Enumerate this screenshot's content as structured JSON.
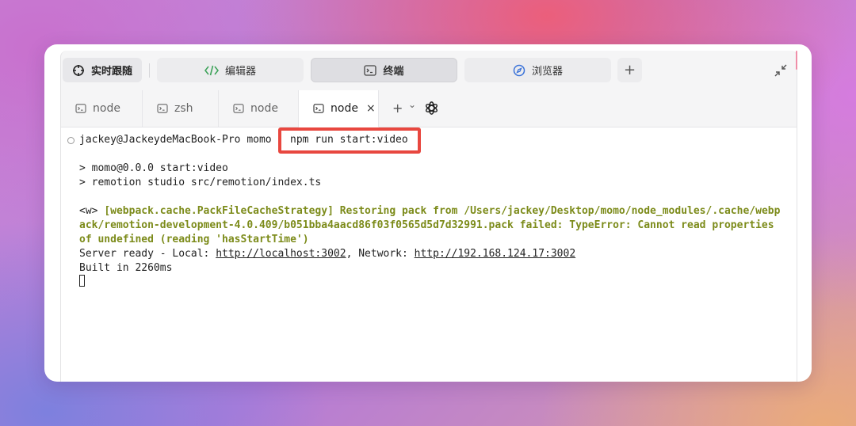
{
  "topbar": {
    "follow_label": "实时跟随",
    "editor_label": "编辑器",
    "terminal_label": "终端",
    "browser_label": "浏览器",
    "add_label": "+"
  },
  "tabs": [
    {
      "label": "node",
      "active": false
    },
    {
      "label": "zsh",
      "active": false
    },
    {
      "label": "node",
      "active": false
    },
    {
      "label": "node",
      "active": true
    }
  ],
  "tab_actions": {
    "add": "+",
    "dropdown": "⌄",
    "close": "×"
  },
  "terminal": {
    "prompt": "jackey@JackeydeMacBook-Pro momo",
    "command": "npm run start:video",
    "lines": [
      "> momo@0.0.0 start:video",
      "> remotion studio src/remotion/index.ts"
    ],
    "warn_prefix": "<w> ",
    "warn_lines": [
      "[webpack.cache.PackFileCacheStrategy] Restoring pack from /Users/jackey/Desktop/momo/node_modules/.cache/webp",
      "ack/remotion-development-4.0.409/b051bba4aacd86f03f0565d5d7d32991.pack failed: TypeError: Cannot read properties",
      "of undefined (reading 'hasStartTime')"
    ],
    "server_prefix": "Server ready - Local: ",
    "local_url": "http://localhost:3002",
    "network_label": ", Network: ",
    "network_url": "http://192.168.124.17:3002",
    "built": "Built in 2260ms"
  },
  "colors": {
    "highlight": "#e8473f",
    "warning": "#7c8b1a"
  },
  "icons": [
    "crosshair-icon",
    "code-icon",
    "terminal-icon",
    "compass-icon",
    "collapse-icon",
    "chatgpt-icon"
  ]
}
